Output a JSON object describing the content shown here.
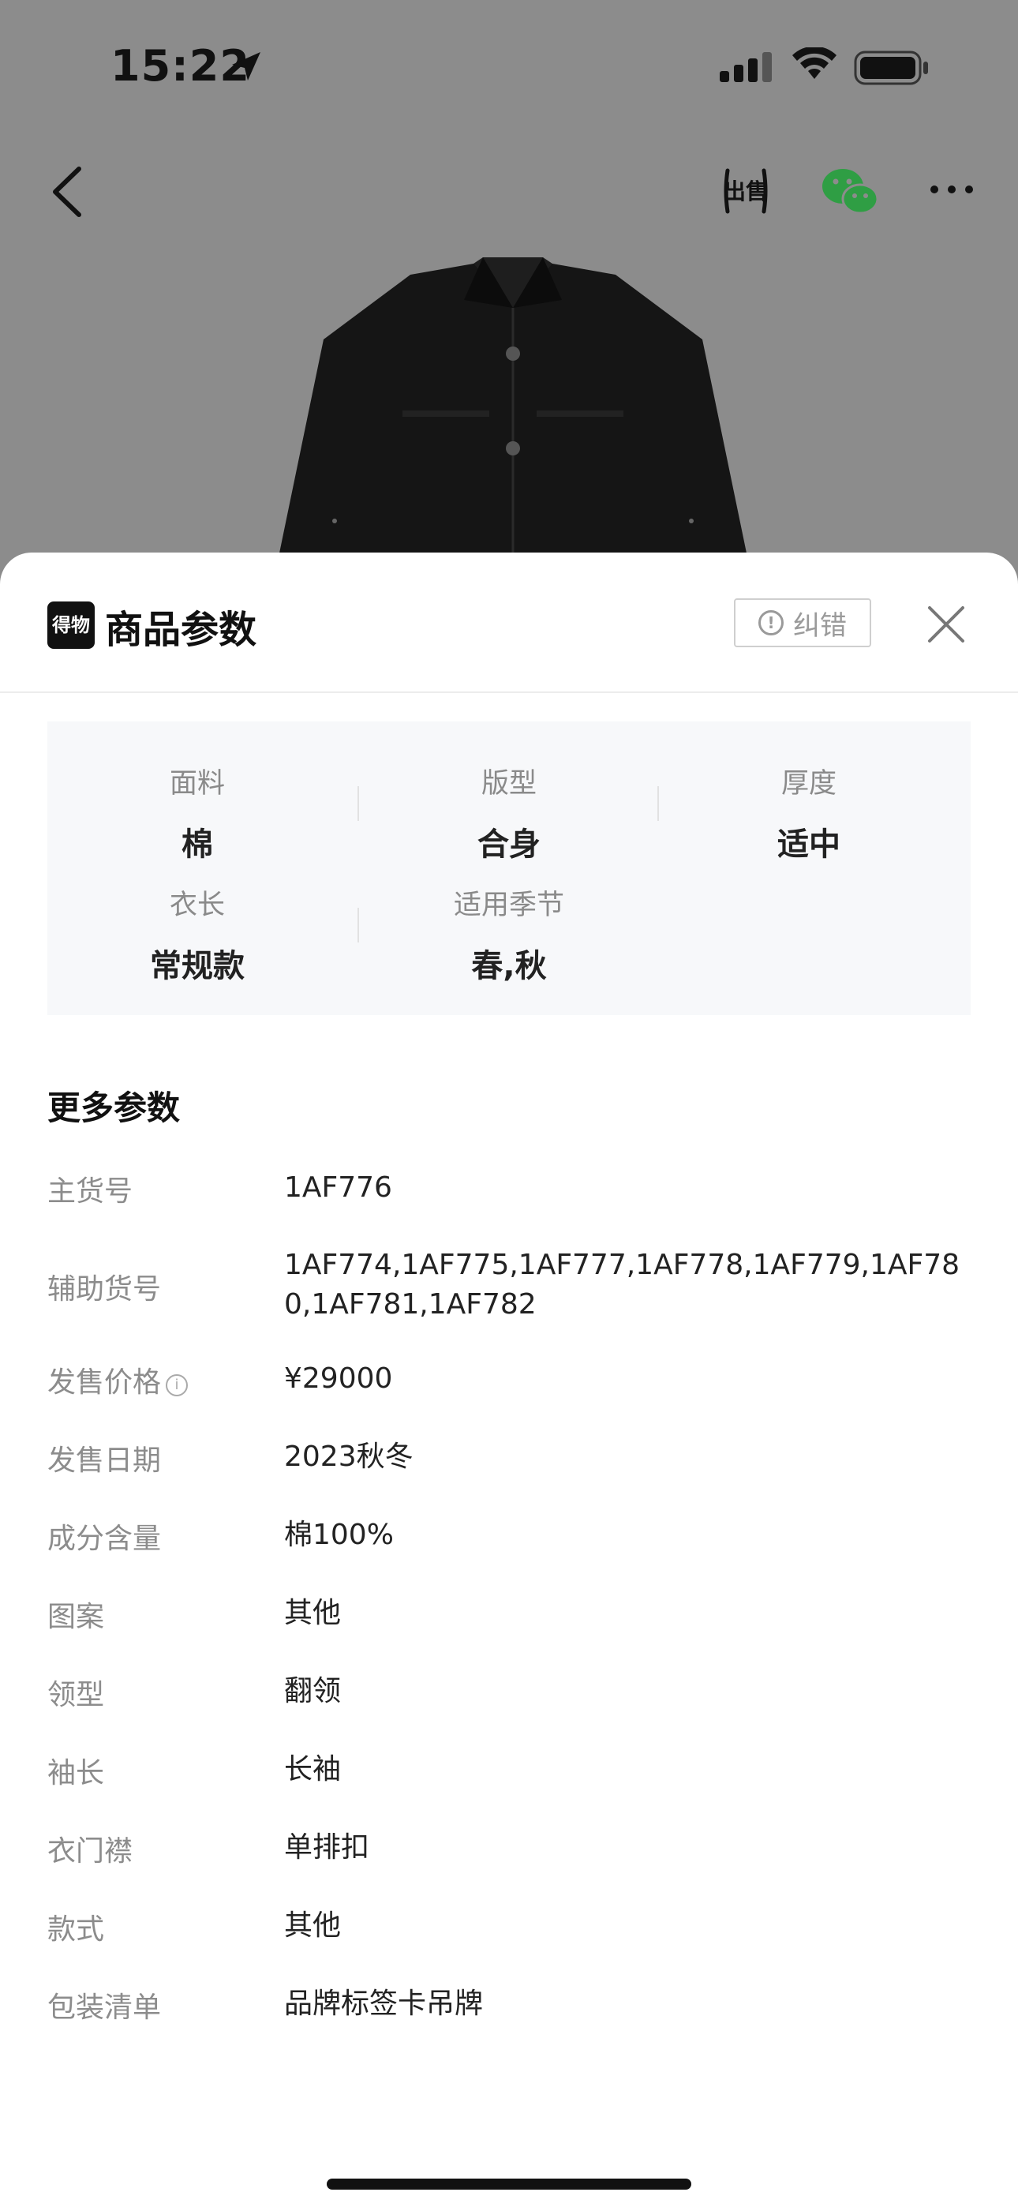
{
  "status_bar": {
    "time": "15:22"
  },
  "nav": {
    "icons": [
      "back-icon",
      "sell-icon",
      "wechat-icon",
      "more-icon"
    ],
    "sell_label": "出售"
  },
  "sheet": {
    "brand_logo": "得物",
    "title": "商品参数",
    "correct_button": "纠错",
    "summary": [
      {
        "label": "面料",
        "value": "棉"
      },
      {
        "label": "版型",
        "value": "合身"
      },
      {
        "label": "厚度",
        "value": "适中"
      },
      {
        "label": "衣长",
        "value": "常规款"
      },
      {
        "label": "适用季节",
        "value": "春,秋"
      }
    ],
    "more_title": "更多参数",
    "params": [
      {
        "label": "主货号",
        "value": "1AF776"
      },
      {
        "label": "辅助货号",
        "value": "1AF774,1AF775,1AF777,1AF778,1AF779,1AF780,1AF781,1AF782"
      },
      {
        "label": "发售价格",
        "value": "¥29000"
      },
      {
        "label": "发售日期",
        "value": "2023秋冬"
      },
      {
        "label": "成分含量",
        "value": "棉100%"
      },
      {
        "label": "图案",
        "value": "其他"
      },
      {
        "label": "领型",
        "value": "翻领"
      },
      {
        "label": "袖长",
        "value": "长袖"
      },
      {
        "label": "衣门襟",
        "value": "单排扣"
      },
      {
        "label": "款式",
        "value": "其他"
      },
      {
        "label": "包装清单",
        "value": "品牌标签卡吊牌"
      }
    ]
  }
}
